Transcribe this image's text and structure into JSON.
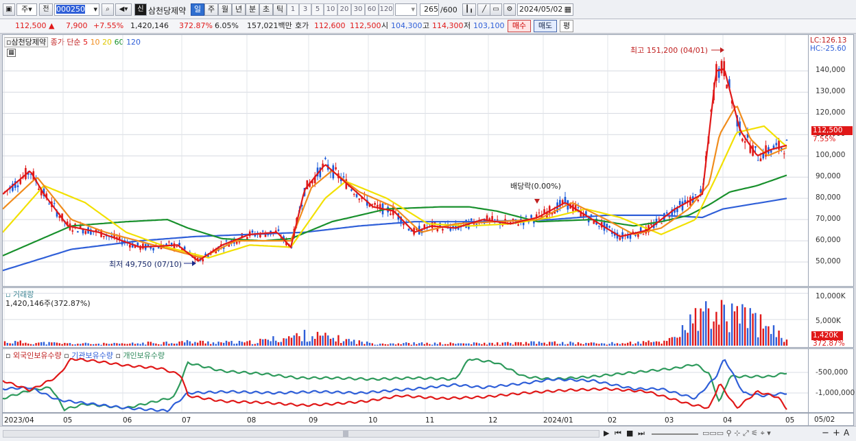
{
  "toolbar": {
    "type_sel": "주",
    "prev_label": "전",
    "code": "000250",
    "badge_sin": "신",
    "stock_name": "삼천당제약",
    "periods": [
      "일",
      "주",
      "월",
      "년",
      "분",
      "초",
      "틱"
    ],
    "active_period": "일",
    "nums": [
      "1",
      "3",
      "5",
      "10",
      "20",
      "30",
      "60",
      "120"
    ],
    "count_value": "265",
    "count_total": "/600",
    "date": "2024/05/02"
  },
  "quote": {
    "price": "112,500",
    "change": "7,900",
    "change_pct": "+7.55%",
    "volume": "1,420,146",
    "vol_ratio": "372.87%",
    "turnover": "6.05%",
    "amount": "157,021백만",
    "hoga_label": "호가",
    "ask": "112,600",
    "bid": "112,500",
    "open_label": "시",
    "open": "104,300",
    "high_label": "고",
    "high": "114,300",
    "low_label": "저",
    "low": "103,100",
    "buy_label": "매수",
    "sell_label": "매도",
    "avg_label": "평"
  },
  "price_panel": {
    "tab_name": "삼천당제약",
    "ma_title": "종가 단순",
    "ma_periods": [
      {
        "label": "5",
        "color": "#e01818"
      },
      {
        "label": "10",
        "color": "#f08c1c"
      },
      {
        "label": "20",
        "color": "#f2e000"
      },
      {
        "label": "60",
        "color": "#18902c"
      },
      {
        "label": "120",
        "color": "#2f5fd8"
      }
    ],
    "high_note": "최고 151,200 (04/01)",
    "low_note": "최저 49,750 (07/10)",
    "dividend_note": "배당락(0.00%)",
    "lc": "LC:126.13",
    "hc": "HC:-25.60",
    "price_tag": "112,500",
    "pct_tag": "7.55%"
  },
  "volume_panel": {
    "title": "거래량",
    "info": "1,420,146주(372.87%)",
    "tag": "1,420K",
    "tag_pct": "372.87%"
  },
  "holding_panel": {
    "series": [
      {
        "name": "외국인보유수량",
        "color": "#e01818"
      },
      {
        "name": "기관보유수량",
        "color": "#2f5fd8"
      },
      {
        "name": "개인보유수량",
        "color": "#2e9a5c"
      }
    ]
  },
  "x_labels": [
    "2023/04",
    "05",
    "06",
    "07",
    "08",
    "09",
    "10",
    "11",
    "12",
    "2024/01",
    "02",
    "03",
    "04",
    "05"
  ],
  "x_axis_right": "05/02",
  "chart_data": [
    {
      "type": "line",
      "title": "삼천당제약 일봉",
      "ylim": [
        40000,
        155000
      ],
      "y_ticks": [
        "140,000",
        "130,000",
        "120,000",
        "110,000",
        "100,000",
        "90,000",
        "80,000",
        "70,000",
        "60,000",
        "50,000"
      ],
      "x": [
        "2023/04",
        "05",
        "06",
        "07",
        "08",
        "09",
        "10",
        "11",
        "12",
        "2024/01",
        "02",
        "03",
        "04",
        "05"
      ],
      "series": [
        {
          "name": "5",
          "values": [
            85000,
            70000,
            64000,
            55000,
            64000,
            95000,
            75000,
            67000,
            69000,
            80000,
            64000,
            80000,
            135000,
            105000
          ]
        },
        {
          "name": "120",
          "values": [
            56000,
            60000,
            62000,
            63000,
            64000,
            66000,
            68000,
            69000,
            69000,
            70000,
            71000,
            72000,
            76000,
            80000
          ]
        }
      ],
      "annotations": [
        "최고 151,200 (04/01)",
        "최저 49,750 (07/10)",
        "배당락(0.00%)"
      ]
    },
    {
      "type": "bar",
      "title": "거래량",
      "y_ticks": [
        "10,000K",
        "5,000K"
      ],
      "ylim": [
        0,
        11000
      ],
      "x": [
        "2023/04",
        "05",
        "06",
        "07",
        "08",
        "09",
        "10",
        "11",
        "12",
        "2024/01",
        "02",
        "03",
        "04",
        "05"
      ],
      "values": [
        900,
        500,
        400,
        900,
        700,
        2500,
        600,
        500,
        500,
        700,
        500,
        900,
        10100,
        1420
      ]
    },
    {
      "type": "line",
      "title": "보유수량",
      "y_ticks": [
        "-500,000",
        "-1,000,000"
      ]
    }
  ],
  "bottom_icons": [
    "play-icon",
    "rewind-icon",
    "stop-icon",
    "fastforward-icon"
  ]
}
